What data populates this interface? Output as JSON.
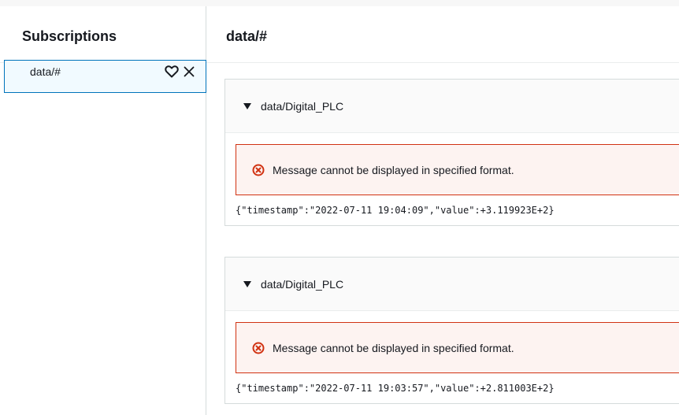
{
  "sidebar": {
    "title": "Subscriptions",
    "items": [
      {
        "label": "data/#"
      }
    ]
  },
  "main": {
    "title": "data/#",
    "messages": [
      {
        "topic": "data/Digital_PLC",
        "error": "Message cannot be displayed in specified format.",
        "payload": "{\"timestamp\":\"2022-07-11 19:04:09\",\"value\":+3.119923E+2}"
      },
      {
        "topic": "data/Digital_PLC",
        "error": "Message cannot be displayed in specified format.",
        "payload": "{\"timestamp\":\"2022-07-11 19:03:57\",\"value\":+2.811003E+2}"
      }
    ]
  },
  "icons": {
    "favorite": "heart-outline-icon",
    "remove": "close-icon",
    "caret": "caret-down-icon",
    "error": "error-circle-icon"
  },
  "colors": {
    "selected_bg": "#f1faff",
    "selected_border": "#0073bb",
    "error_bg": "#fdf3f1",
    "error_border": "#d13212",
    "text": "#16191f"
  }
}
